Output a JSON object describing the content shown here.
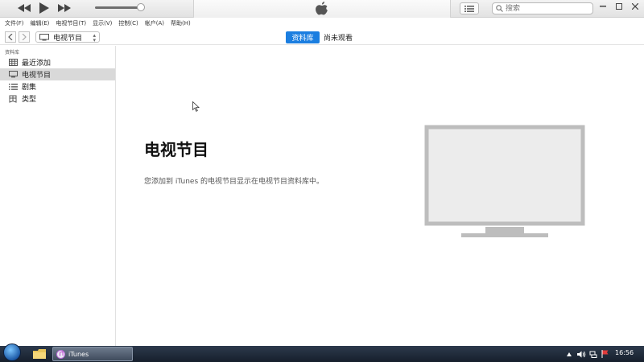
{
  "toolbar": {
    "search_placeholder": "搜索",
    "icons": [
      "rewind-icon",
      "play-icon",
      "fast-forward-icon",
      "apple-logo-icon",
      "list-view-icon",
      "search-icon"
    ],
    "volume_level": 0.85
  },
  "menu": {
    "items": [
      "文件(F)",
      "编辑(E)",
      "电视节目(T)",
      "显示(V)",
      "控制(C)",
      "帐户(A)",
      "帮助(H)"
    ]
  },
  "nav": {
    "media_type": "电视节目",
    "tabs": [
      {
        "label": "资料库",
        "active": true
      },
      {
        "label": "尚未观看",
        "active": false
      }
    ]
  },
  "sidebar": {
    "heading": "资料库",
    "items": [
      {
        "label": "最近添加",
        "icon": "grid-icon",
        "selected": false
      },
      {
        "label": "电视节目",
        "icon": "tv-icon",
        "selected": true
      },
      {
        "label": "剧集",
        "icon": "list-icon",
        "selected": false
      },
      {
        "label": "类型",
        "icon": "genre-icon",
        "selected": false
      }
    ]
  },
  "main": {
    "title": "电视节目",
    "description": "您添加到 iTunes 的电视节目显示在电视节目资料库中。"
  },
  "taskbar": {
    "task_label": "iTunes",
    "clock": "16:56"
  },
  "colors": {
    "accent": "#1b7ee0",
    "selected_row": "#d9d9d9",
    "tv_illustration": "#bdbdbd"
  }
}
